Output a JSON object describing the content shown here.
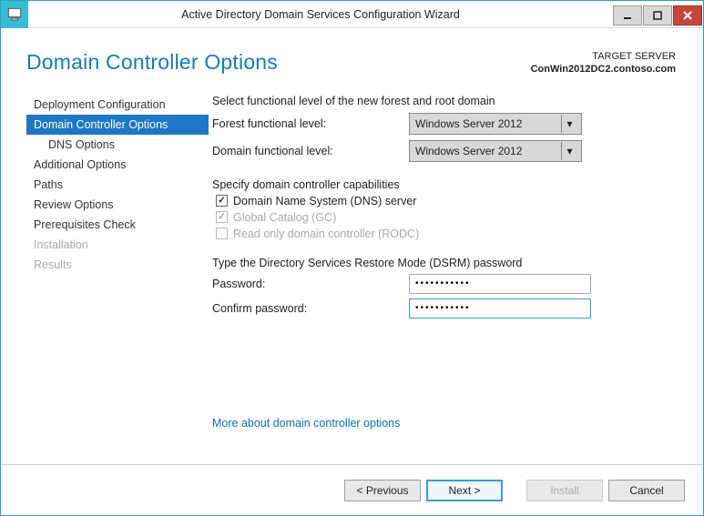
{
  "window": {
    "title": "Active Directory Domain Services Configuration Wizard"
  },
  "header": {
    "page_title": "Domain Controller Options",
    "target_label": "TARGET SERVER",
    "target_host": "ConWin2012DC2.contoso.com"
  },
  "sidebar": {
    "items": [
      {
        "label": "Deployment Configuration",
        "state": "normal"
      },
      {
        "label": "Domain Controller Options",
        "state": "selected"
      },
      {
        "label": "DNS Options",
        "state": "child"
      },
      {
        "label": "Additional Options",
        "state": "normal"
      },
      {
        "label": "Paths",
        "state": "normal"
      },
      {
        "label": "Review Options",
        "state": "normal"
      },
      {
        "label": "Prerequisites Check",
        "state": "normal"
      },
      {
        "label": "Installation",
        "state": "disabled"
      },
      {
        "label": "Results",
        "state": "disabled"
      }
    ]
  },
  "main": {
    "functional_level_text": "Select functional level of the new forest and root domain",
    "forest_level_label": "Forest functional level:",
    "forest_level_value": "Windows Server 2012",
    "domain_level_label": "Domain functional level:",
    "domain_level_value": "Windows Server 2012",
    "capabilities_text": "Specify domain controller capabilities",
    "cap_dns": "Domain Name System (DNS) server",
    "cap_gc": "Global Catalog (GC)",
    "cap_rodc": "Read only domain controller (RODC)",
    "dsrm_text": "Type the Directory Services Restore Mode (DSRM) password",
    "password_label": "Password:",
    "password_value": "•••••••••••",
    "confirm_label": "Confirm password:",
    "confirm_value": "•••••••••••",
    "more_link": "More about domain controller options"
  },
  "footer": {
    "previous": "< Previous",
    "next": "Next >",
    "install": "Install",
    "cancel": "Cancel"
  }
}
